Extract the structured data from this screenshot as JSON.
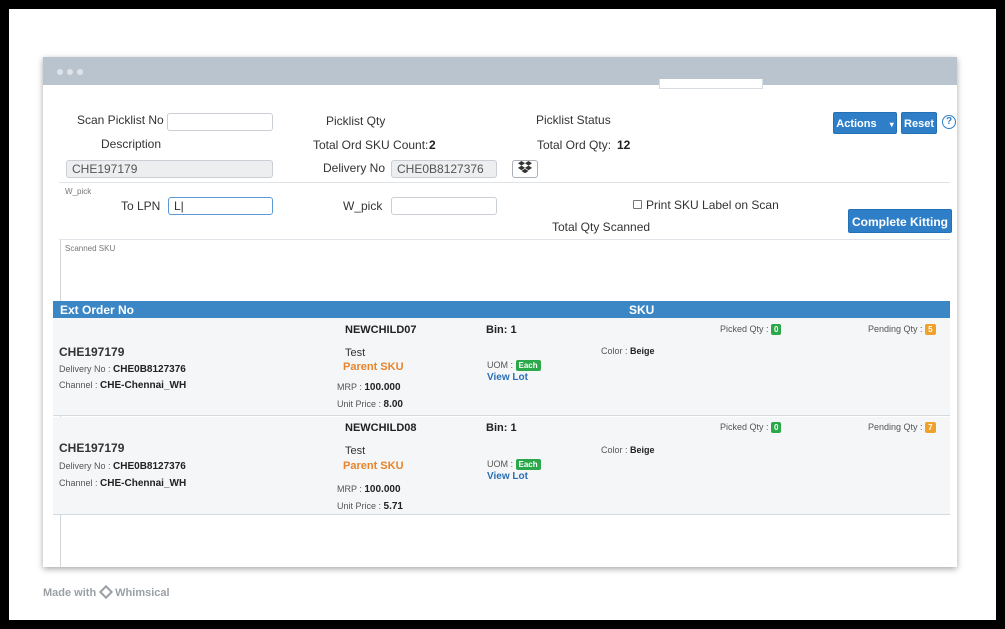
{
  "form": {
    "scan_picklist_label": "Scan Picklist No",
    "description_label": "Description",
    "picklist_qty_label": "Picklist Qty",
    "total_ord_sku_label": "Total Ord SKU Count:",
    "total_ord_sku_value": "2",
    "delivery_no_label": "Delivery No",
    "delivery_no_value": "CHE0B8127376",
    "picklist_status_label": "Picklist Status",
    "total_ord_qty_label": "Total Ord Qty:",
    "total_ord_qty_value": "12",
    "description_value": "CHE197179",
    "actions_label": "Actions",
    "reset_label": "Reset"
  },
  "wpick": {
    "section_label": "W_pick",
    "to_lpn_label": "To LPN",
    "to_lpn_value": "L|",
    "w_pick_label": "W_pick",
    "print_sku_label": "Print SKU Label on Scan",
    "total_qty_scanned_label": "Total Qty Scanned",
    "complete_kitting_label": "Complete Kitting"
  },
  "scanned": {
    "section_label": "Scanned SKU",
    "columns": [
      "Ext Order No",
      "SKU"
    ],
    "rows": [
      {
        "ext_order": "CHE197179",
        "delivery_label": "Delivery No :",
        "delivery_value": "CHE0B8127376",
        "channel_label": "Channel :",
        "channel_value": "CHE-Chennai_WH",
        "sku_code": "NEWCHILD07",
        "sku_name": "Test",
        "parent_sku": "Parent SKU",
        "mrp_label": "MRP :",
        "mrp_value": "100.000",
        "unit_price_label": "Unit Price :",
        "unit_price_value": "8.00",
        "bin_label": "Bin:",
        "bin_value": "1",
        "uom_label": "UOM :",
        "uom_value": "Each",
        "view_lot": "View Lot",
        "color_label": "Color :",
        "color_value": "Beige",
        "picked_label": "Picked Qty :",
        "picked_value": "0",
        "pending_label": "Pending Qty :",
        "pending_value": "5"
      },
      {
        "ext_order": "CHE197179",
        "delivery_label": "Delivery No :",
        "delivery_value": "CHE0B8127376",
        "channel_label": "Channel :",
        "channel_value": "CHE-Chennai_WH",
        "sku_code": "NEWCHILD08",
        "sku_name": "Test",
        "parent_sku": "Parent SKU",
        "mrp_label": "MRP :",
        "mrp_value": "100.000",
        "unit_price_label": "Unit Price :",
        "unit_price_value": "5.71",
        "bin_label": "Bin:",
        "bin_value": "1",
        "uom_label": "UOM :",
        "uom_value": "Each",
        "view_lot": "View Lot",
        "color_label": "Color :",
        "color_value": "Beige",
        "picked_label": "Picked Qty :",
        "picked_value": "0",
        "pending_label": "Pending Qty :",
        "pending_value": "7"
      }
    ]
  },
  "footer": {
    "made_with": "Made with",
    "brand": "Whimsical"
  },
  "icons": {
    "dropbox": "dropbox-icon",
    "help": "help-icon",
    "caret": "caret-down-icon"
  }
}
